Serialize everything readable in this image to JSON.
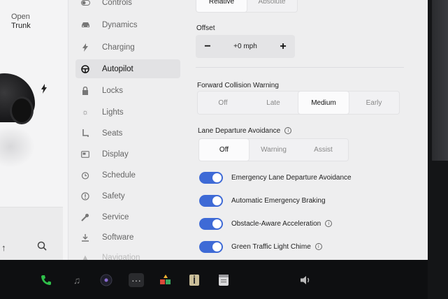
{
  "car_panel": {
    "trunk_status": "Open",
    "trunk_label": "Trunk"
  },
  "menu": {
    "items": [
      {
        "label": "Controls",
        "icon": "toggle-icon"
      },
      {
        "label": "Dynamics",
        "icon": "car-icon"
      },
      {
        "label": "Charging",
        "icon": "bolt-icon"
      },
      {
        "label": "Autopilot",
        "icon": "steering-wheel-icon",
        "active": true
      },
      {
        "label": "Locks",
        "icon": "lock-icon"
      },
      {
        "label": "Lights",
        "icon": "light-icon"
      },
      {
        "label": "Seats",
        "icon": "seat-icon"
      },
      {
        "label": "Display",
        "icon": "display-icon"
      },
      {
        "label": "Schedule",
        "icon": "alarm-icon"
      },
      {
        "label": "Safety",
        "icon": "safety-icon"
      },
      {
        "label": "Service",
        "icon": "wrench-icon"
      },
      {
        "label": "Software",
        "icon": "download-icon"
      },
      {
        "label": "Navigation",
        "icon": "navigation-icon"
      }
    ]
  },
  "speed_mode": {
    "options": [
      "Relative",
      "Absolute"
    ],
    "selected": "Relative"
  },
  "offset": {
    "label": "Offset",
    "value": "+0 mph",
    "minus": "−",
    "plus": "+"
  },
  "fcw": {
    "label": "Forward Collision Warning",
    "options": [
      "Off",
      "Late",
      "Medium",
      "Early"
    ],
    "selected": "Medium"
  },
  "lda": {
    "label": "Lane Departure Avoidance",
    "options": [
      "Off",
      "Warning",
      "Assist"
    ],
    "selected": "Off"
  },
  "toggles": [
    {
      "label": "Emergency Lane Departure Avoidance",
      "on": true,
      "info": false
    },
    {
      "label": "Automatic Emergency Braking",
      "on": true,
      "info": false
    },
    {
      "label": "Obstacle-Aware Acceleration",
      "on": true,
      "info": true
    },
    {
      "label": "Green Traffic Light Chime",
      "on": true,
      "info": true
    }
  ],
  "taskbar": {
    "icons": [
      "phone-icon",
      "music-icon",
      "camera-icon",
      "more-icon",
      "games-icon",
      "manual-icon",
      "calendar-icon",
      "volume-icon"
    ]
  },
  "colors": {
    "toggle_on": "#3e6ad6",
    "phone_green": "#2fbf4a"
  }
}
